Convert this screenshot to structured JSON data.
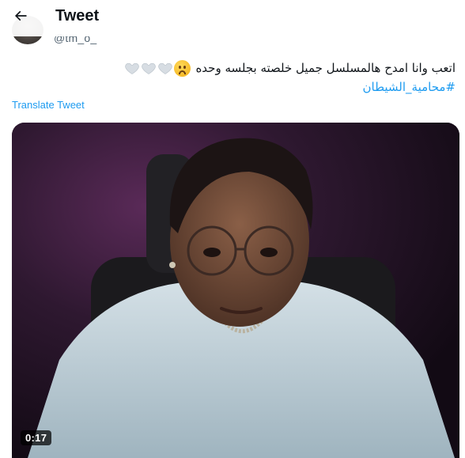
{
  "header": {
    "title": "Tweet",
    "back_icon": "arrow-left-icon"
  },
  "author": {
    "handle": "@tm_o_"
  },
  "tweet": {
    "text": "اتعب وانا امدح هالمسلسل جميل خلصته بجلسه وحده",
    "emojis": [
      "frowning-face-icon",
      "white-heart-icon",
      "white-heart-icon",
      "white-heart-icon"
    ],
    "hashtag": "#محامية_الشيطان",
    "translate_label": "Translate Tweet"
  },
  "media": {
    "type": "video",
    "duration": "0:17"
  },
  "colors": {
    "accent": "#1d9bf0",
    "text": "#0f1419",
    "secondary": "#536471"
  }
}
